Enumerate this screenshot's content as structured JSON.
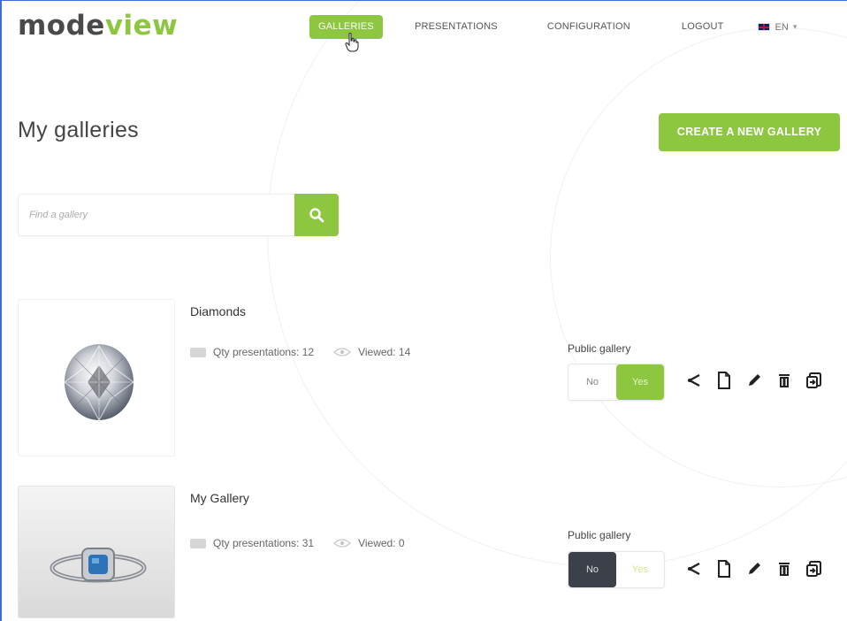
{
  "logo": {
    "part1": "mode",
    "part2": "view"
  },
  "nav": {
    "items": [
      {
        "label": "GALLERIES",
        "active": true
      },
      {
        "label": "PRESENTATIONS",
        "active": false
      },
      {
        "label": "CONFIGURATION",
        "active": false
      },
      {
        "label": "LOGOUT",
        "active": false
      }
    ],
    "language": "EN"
  },
  "page": {
    "title": "My galleries",
    "create_button": "CREATE A NEW GALLERY"
  },
  "search": {
    "placeholder": "Find a gallery"
  },
  "galleries": [
    {
      "name": "Diamonds",
      "qty_label": "Qty presentations:",
      "qty": "12",
      "viewed_label": "Viewed:",
      "viewed": "14",
      "public_label": "Public gallery",
      "toggle_no": "No",
      "toggle_yes": "Yes",
      "public": "Yes"
    },
    {
      "name": "My Gallery",
      "qty_label": "Qty presentations:",
      "qty": "31",
      "viewed_label": "Viewed:",
      "viewed": "0",
      "public_label": "Public gallery",
      "toggle_no": "No",
      "toggle_yes": "Yes",
      "public": "No"
    }
  ],
  "colors": {
    "accent": "#8dc63f",
    "dark_toggle": "#3c4049",
    "text": "#333333"
  },
  "icons": [
    "search-icon",
    "folder-icon",
    "eye-icon",
    "share-icon",
    "copy-icon",
    "edit-icon",
    "delete-icon",
    "export-icon",
    "hand-cursor-icon",
    "uk-flag-icon",
    "caret-down-icon"
  ]
}
